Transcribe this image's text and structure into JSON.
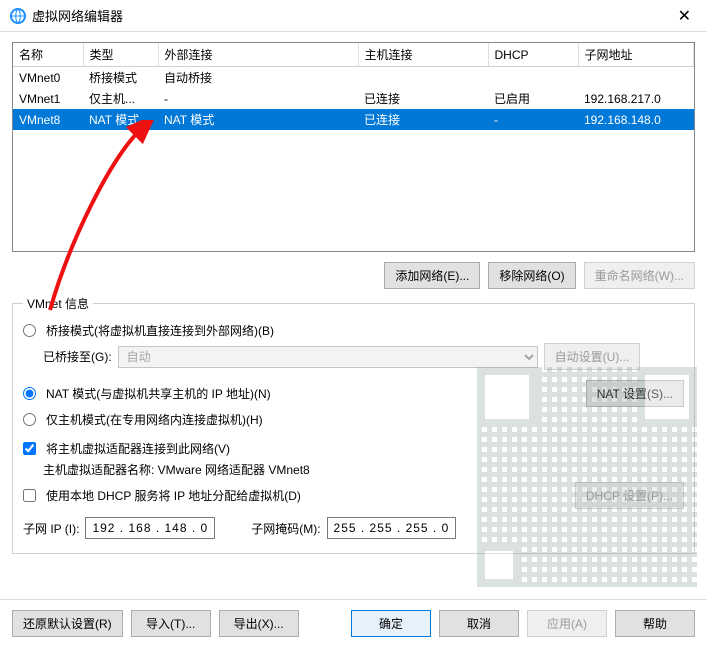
{
  "window": {
    "title": "虚拟网络编辑器",
    "close": "✕"
  },
  "table": {
    "headers": [
      "名称",
      "类型",
      "外部连接",
      "主机连接",
      "DHCP",
      "子网地址"
    ],
    "rows": [
      {
        "name": "VMnet0",
        "type": "桥接模式",
        "ext": "自动桥接",
        "host": "",
        "dhcp": "",
        "subnet": ""
      },
      {
        "name": "VMnet1",
        "type": "仅主机...",
        "ext": "-",
        "host": "已连接",
        "dhcp": "已启用",
        "subnet": "192.168.217.0"
      },
      {
        "name": "VMnet8",
        "type": "NAT 模式",
        "ext": "NAT 模式",
        "host": "已连接",
        "dhcp": "-",
        "subnet": "192.168.148.0"
      }
    ]
  },
  "net_buttons": {
    "add": "添加网络(E)...",
    "remove": "移除网络(O)",
    "rename": "重命名网络(W)..."
  },
  "info": {
    "legend": "VMnet 信息",
    "bridge": "桥接模式(将虚拟机直接连接到外部网络)(B)",
    "bridge_to": "已桥接至(G):",
    "bridge_sel": "自动",
    "auto_set": "自动设置(U)...",
    "nat": "NAT 模式(与虚拟机共享主机的 IP 地址)(N)",
    "nat_set": "NAT 设置(S)...",
    "hostonly": "仅主机模式(在专用网络内连接虚拟机)(H)",
    "connect_vhost": "将主机虚拟适配器连接到此网络(V)",
    "adapter_label": "主机虚拟适配器名称: VMware 网络适配器 VMnet8",
    "dhcp": "使用本地 DHCP 服务将 IP 地址分配给虚拟机(D)",
    "dhcp_set": "DHCP 设置(P)...",
    "subnet_ip_label": "子网 IP (I):",
    "subnet_ip": "192 . 168 . 148 .  0",
    "mask_label": "子网掩码(M):",
    "mask": "255 . 255 . 255 .  0"
  },
  "dialog": {
    "restore": "还原默认设置(R)",
    "import": "导入(T)...",
    "export": "导出(X)...",
    "ok": "确定",
    "cancel": "取消",
    "apply": "应用(A)",
    "help": "帮助"
  }
}
